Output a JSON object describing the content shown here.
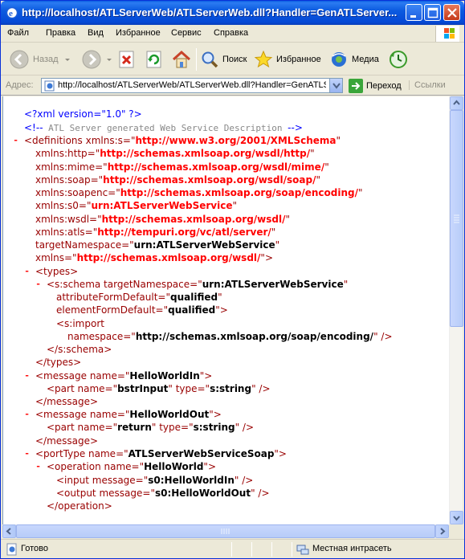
{
  "window": {
    "title": "http://localhost/ATLServerWeb/ATLServerWeb.dll?Handler=GenATLServer..."
  },
  "menu": {
    "items": [
      "Файл",
      "Правка",
      "Вид",
      "Избранное",
      "Сервис",
      "Справка"
    ]
  },
  "toolbar": {
    "back_label": "Назад",
    "search_label": "Поиск",
    "favorites_label": "Избранное",
    "media_label": "Медиа"
  },
  "address": {
    "label": "Адрес:",
    "url": "http://localhost/ATLServerWeb/ATLServerWeb.dll?Handler=GenATLSe",
    "go_label": "Переход",
    "links_label": "Ссылки"
  },
  "content": {
    "lines": [
      {
        "parts": [
          {
            "c": "pi",
            "t": "<?xml version=\"1.0\" ?>"
          }
        ]
      },
      {
        "parts": [
          {
            "c": "pi",
            "t": "<!--"
          },
          {
            "c": "cmt",
            "t": "  ATL Server generated Web Service Description  "
          },
          {
            "c": "pi",
            "t": "-->"
          }
        ]
      },
      {
        "minus": true,
        "parts": [
          {
            "c": "tag",
            "t": "<definitions "
          },
          {
            "c": "attr",
            "t": "xmlns:s=\""
          },
          {
            "c": "ns",
            "t": "http://www.w3.org/2001/XMLSchema"
          },
          {
            "c": "attr",
            "t": "\""
          }
        ]
      },
      {
        "parts": [
          {
            "c": "attr",
            "t": "xmlns:http=\""
          },
          {
            "c": "ns",
            "t": "http://schemas.xmlsoap.org/wsdl/http/"
          },
          {
            "c": "attr",
            "t": "\""
          }
        ]
      },
      {
        "parts": [
          {
            "c": "attr",
            "t": "xmlns:mime=\""
          },
          {
            "c": "ns",
            "t": "http://schemas.xmlsoap.org/wsdl/mime/"
          },
          {
            "c": "attr",
            "t": "\""
          }
        ]
      },
      {
        "parts": [
          {
            "c": "attr",
            "t": "xmlns:soap=\""
          },
          {
            "c": "ns",
            "t": "http://schemas.xmlsoap.org/wsdl/soap/"
          },
          {
            "c": "attr",
            "t": "\""
          }
        ]
      },
      {
        "parts": [
          {
            "c": "attr",
            "t": "xmlns:soapenc=\""
          },
          {
            "c": "ns",
            "t": "http://schemas.xmlsoap.org/soap/encoding/"
          },
          {
            "c": "attr",
            "t": "\""
          }
        ]
      },
      {
        "parts": [
          {
            "c": "attr",
            "t": "xmlns:s0=\""
          },
          {
            "c": "ns",
            "t": "urn:ATLServerWebService"
          },
          {
            "c": "attr",
            "t": "\""
          }
        ]
      },
      {
        "parts": [
          {
            "c": "attr",
            "t": "xmlns:wsdl=\""
          },
          {
            "c": "ns",
            "t": "http://schemas.xmlsoap.org/wsdl/"
          },
          {
            "c": "attr",
            "t": "\""
          }
        ]
      },
      {
        "parts": [
          {
            "c": "attr",
            "t": "xmlns:atls=\""
          },
          {
            "c": "ns",
            "t": "http://tempuri.org/vc/atl/server/"
          },
          {
            "c": "attr",
            "t": "\""
          }
        ]
      },
      {
        "parts": [
          {
            "c": "attr",
            "t": "targetNamespace=\""
          },
          {
            "c": "val",
            "t": "urn:ATLServerWebService"
          },
          {
            "c": "attr",
            "t": "\""
          }
        ]
      },
      {
        "parts": [
          {
            "c": "attr",
            "t": "xmlns=\""
          },
          {
            "c": "ns",
            "t": "http://schemas.xmlsoap.org/wsdl/"
          },
          {
            "c": "attr",
            "t": "\">"
          }
        ]
      },
      {
        "minus": true,
        "parts": [
          {
            "c": "tag",
            "t": "<types>"
          }
        ]
      },
      {
        "minus": true,
        "parts": [
          {
            "c": "tag",
            "t": "<s:schema "
          },
          {
            "c": "attr",
            "t": "targetNamespace=\""
          },
          {
            "c": "val",
            "t": "urn:ATLServerWebService"
          },
          {
            "c": "attr",
            "t": "\""
          }
        ]
      },
      {
        "parts": [
          {
            "c": "attr",
            "t": "attributeFormDefault=\""
          },
          {
            "c": "val",
            "t": "qualified"
          },
          {
            "c": "attr",
            "t": "\""
          }
        ]
      },
      {
        "parts": [
          {
            "c": "attr",
            "t": "elementFormDefault=\""
          },
          {
            "c": "val",
            "t": "qualified"
          },
          {
            "c": "attr",
            "t": "\">"
          }
        ]
      },
      {
        "parts": [
          {
            "c": "tag",
            "t": "<s:import"
          }
        ]
      },
      {
        "parts": [
          {
            "c": "attr",
            "t": "namespace=\""
          },
          {
            "c": "val",
            "t": "http://schemas.xmlsoap.org/soap/encoding/"
          },
          {
            "c": "attr",
            "t": "\" />"
          }
        ]
      },
      {
        "parts": [
          {
            "c": "tag",
            "t": "</s:schema>"
          }
        ]
      },
      {
        "parts": [
          {
            "c": "tag",
            "t": "</types>"
          }
        ]
      },
      {
        "minus": true,
        "parts": [
          {
            "c": "tag",
            "t": "<message "
          },
          {
            "c": "attr",
            "t": "name=\""
          },
          {
            "c": "val",
            "t": "HelloWorldIn"
          },
          {
            "c": "attr",
            "t": "\">"
          }
        ]
      },
      {
        "parts": [
          {
            "c": "tag",
            "t": "<part "
          },
          {
            "c": "attr",
            "t": "name=\""
          },
          {
            "c": "val",
            "t": "bstrInput"
          },
          {
            "c": "attr",
            "t": "\" type=\""
          },
          {
            "c": "val",
            "t": "s:string"
          },
          {
            "c": "attr",
            "t": "\" />"
          }
        ]
      },
      {
        "parts": [
          {
            "c": "tag",
            "t": "</message>"
          }
        ]
      },
      {
        "minus": true,
        "parts": [
          {
            "c": "tag",
            "t": "<message "
          },
          {
            "c": "attr",
            "t": "name=\""
          },
          {
            "c": "val",
            "t": "HelloWorldOut"
          },
          {
            "c": "attr",
            "t": "\">"
          }
        ]
      },
      {
        "parts": [
          {
            "c": "tag",
            "t": "<part "
          },
          {
            "c": "attr",
            "t": "name=\""
          },
          {
            "c": "val",
            "t": "return"
          },
          {
            "c": "attr",
            "t": "\" type=\""
          },
          {
            "c": "val",
            "t": "s:string"
          },
          {
            "c": "attr",
            "t": "\" />"
          }
        ]
      },
      {
        "parts": [
          {
            "c": "tag",
            "t": "</message>"
          }
        ]
      },
      {
        "minus": true,
        "parts": [
          {
            "c": "tag",
            "t": "<portType "
          },
          {
            "c": "attr",
            "t": "name=\""
          },
          {
            "c": "val",
            "t": "ATLServerWebServiceSoap"
          },
          {
            "c": "attr",
            "t": "\">"
          }
        ]
      },
      {
        "minus": true,
        "parts": [
          {
            "c": "tag",
            "t": "<operation "
          },
          {
            "c": "attr",
            "t": "name=\""
          },
          {
            "c": "val",
            "t": "HelloWorld"
          },
          {
            "c": "attr",
            "t": "\">"
          }
        ]
      },
      {
        "parts": [
          {
            "c": "tag",
            "t": "<input "
          },
          {
            "c": "attr",
            "t": "message=\""
          },
          {
            "c": "val",
            "t": "s0:HelloWorldIn"
          },
          {
            "c": "attr",
            "t": "\" />"
          }
        ]
      },
      {
        "parts": [
          {
            "c": "tag",
            "t": "<output "
          },
          {
            "c": "attr",
            "t": "message=\""
          },
          {
            "c": "val",
            "t": "s0:HelloWorldOut"
          },
          {
            "c": "attr",
            "t": "\" />"
          }
        ]
      },
      {
        "parts": [
          {
            "c": "tag",
            "t": "</operation>"
          }
        ]
      }
    ]
  },
  "status": {
    "text": "Готово",
    "zone": "Местная интрасеть"
  },
  "colors": {
    "titlebar": "#0a5de3",
    "tag": "#990000",
    "namespace_value": "#ff0000",
    "pi": "#0000ff"
  }
}
